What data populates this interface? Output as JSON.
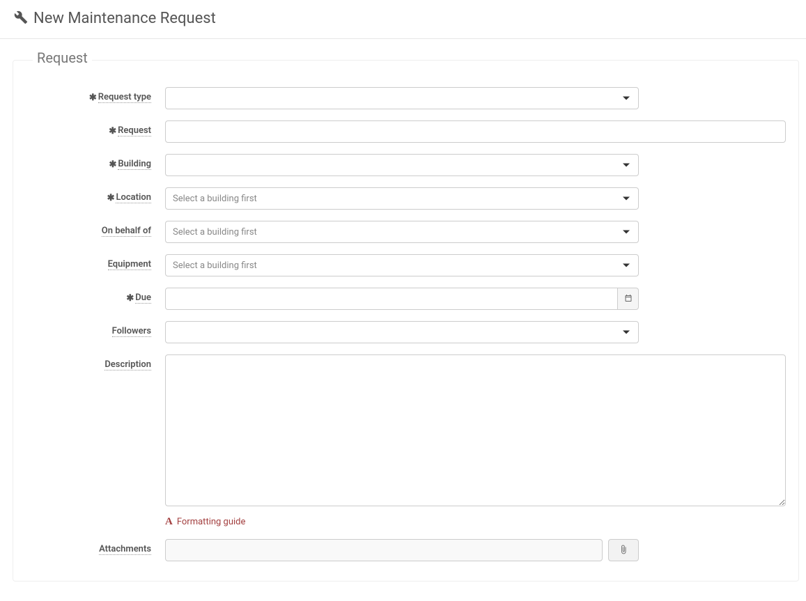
{
  "header": {
    "title": "New Maintenance Request"
  },
  "form": {
    "legend": "Request",
    "fields": {
      "request_type": {
        "label": "Request type",
        "required": true,
        "placeholder": ""
      },
      "request": {
        "label": "Request",
        "required": true,
        "value": ""
      },
      "building": {
        "label": "Building",
        "required": true,
        "placeholder": ""
      },
      "location": {
        "label": "Location",
        "required": true,
        "placeholder": "Select a building first"
      },
      "on_behalf_of": {
        "label": "On behalf of",
        "required": false,
        "placeholder": "Select a building first"
      },
      "equipment": {
        "label": "Equipment",
        "required": false,
        "placeholder": "Select a building first"
      },
      "due": {
        "label": "Due",
        "required": true,
        "value": ""
      },
      "followers": {
        "label": "Followers",
        "required": false,
        "placeholder": ""
      },
      "description": {
        "label": "Description",
        "required": false,
        "value": ""
      },
      "attachments": {
        "label": "Attachments",
        "required": false,
        "value": ""
      }
    },
    "formatting_guide": "Formatting guide"
  }
}
